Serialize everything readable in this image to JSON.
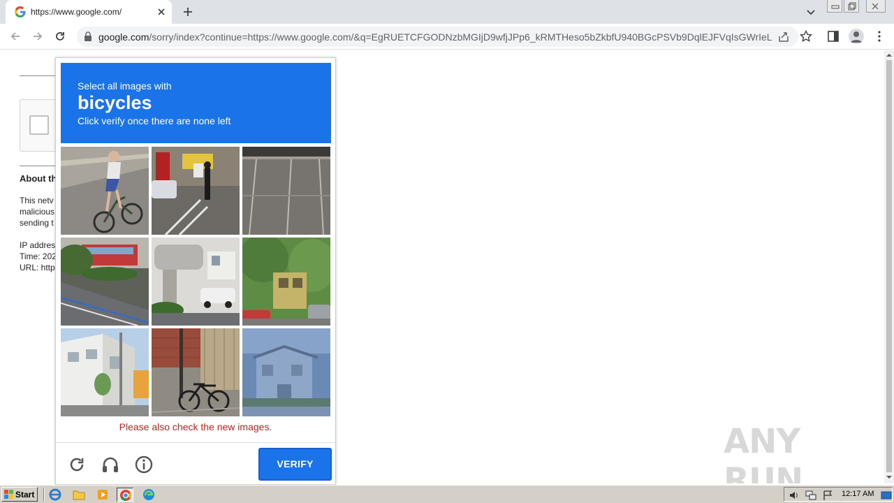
{
  "browser": {
    "tab_title": "https://www.google.com/",
    "url_host": "google.com",
    "url_path": "/sorry/index?continue=https://www.google.com/&q=EgRUETCFGODNzbMGIjD9wfjJPp6_kRMTHeso5bZkbfU940BGcPSVb9DqlEJFVqIsGWrIeLui..."
  },
  "page": {
    "about_title": "About th",
    "about_lines": [
      "This netv",
      "malicious",
      "sending t"
    ],
    "info_lines": [
      "IP addres",
      "Time: 202",
      "URL: http"
    ]
  },
  "captcha": {
    "line1": "Select all images with",
    "keyword": "bicycles",
    "line3": "Click verify once there are none left",
    "notice": "Please also check the new images.",
    "verify_label": "VERIFY",
    "tiles": [
      "cyclist on road",
      "street with pedestrian and vending machine",
      "empty parking lot",
      "road with bus and trees",
      "apartment building with car",
      "house with trees and cars",
      "white apartment building",
      "parked bicycle by brick wall",
      "faded house"
    ],
    "colors": {
      "header": "#1a73e8",
      "notice": "#c5221f",
      "button": "#1a73e8"
    }
  },
  "watermark": "ANY RUN",
  "taskbar": {
    "start_label": "Start",
    "clock": "12:17 AM"
  }
}
